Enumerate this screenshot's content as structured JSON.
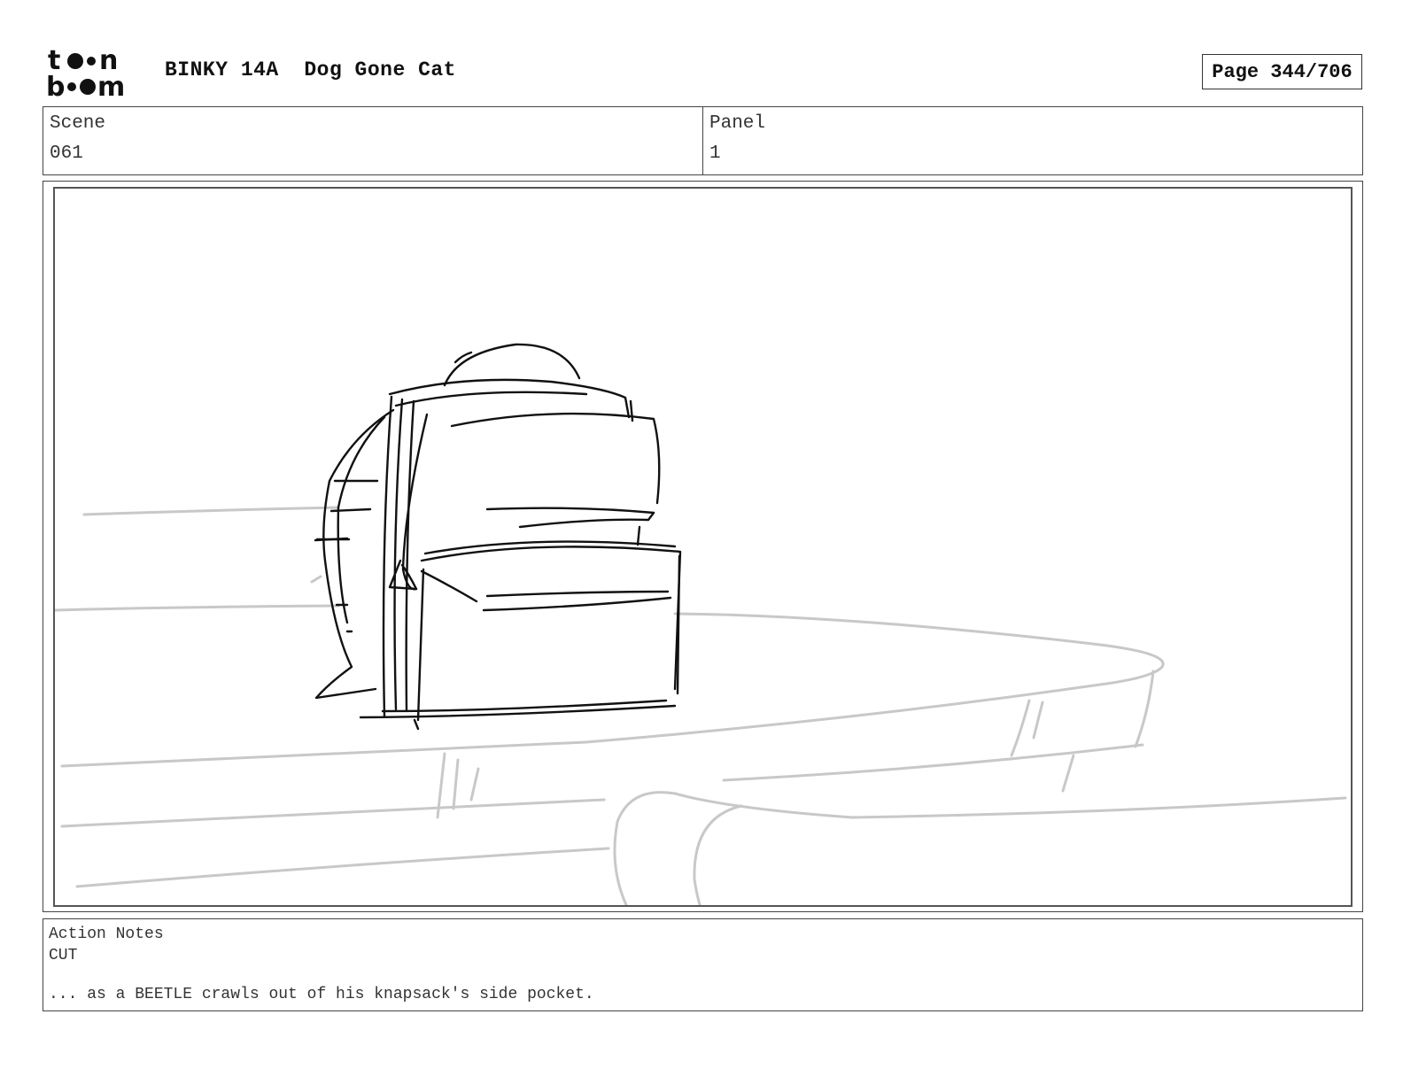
{
  "header": {
    "logo_text_top": "toon",
    "logo_text_bottom": "boom",
    "show_code": "BINKY 14A",
    "episode_title": "Dog Gone Cat",
    "page_label": "Page 344/706"
  },
  "info": {
    "scene_label": "Scene",
    "scene_value": "061",
    "panel_label": "Panel",
    "panel_value": "1"
  },
  "panel_image": {
    "subject": "knapsack-on-table-sketch",
    "line_color": "#111111",
    "background_line_color": "#c8c8c8"
  },
  "notes": {
    "label": "Action Notes",
    "line1": "CUT",
    "line2": "... as a BEETLE crawls out of his knapsack's side pocket."
  }
}
